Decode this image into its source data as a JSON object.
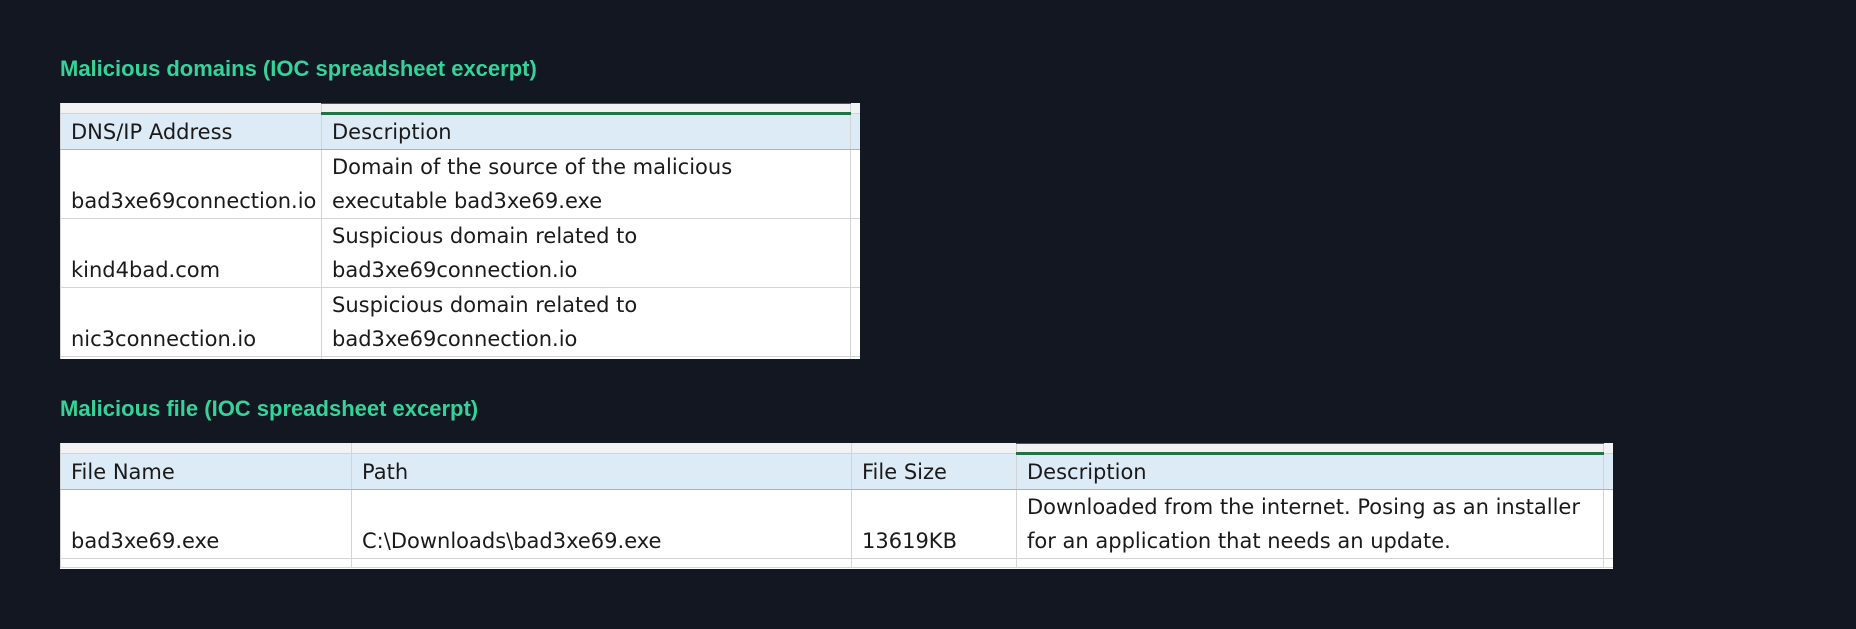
{
  "domains_section": {
    "title": "Malicious domains (IOC spreadsheet excerpt)",
    "headers": [
      "DNS/IP Address",
      "Description"
    ],
    "rows": [
      {
        "address": "bad3xe69connection.io",
        "description": "Domain of the source of the malicious executable bad3xe69.exe"
      },
      {
        "address": "kind4bad.com",
        "description": "Suspicious domain related to bad3xe69connection.io"
      },
      {
        "address": "nic3connection.io",
        "description": "Suspicious domain related to bad3xe69connection.io"
      }
    ]
  },
  "files_section": {
    "title": "Malicious file (IOC spreadsheet excerpt)",
    "headers": [
      "File Name",
      "Path",
      "File Size",
      "Description"
    ],
    "rows": [
      {
        "file_name": "bad3xe69.exe",
        "path": "C:\\Downloads\\bad3xe69.exe",
        "file_size": "13619KB",
        "description": "Downloaded from the internet. Posing as an installer for an application that needs an update."
      }
    ]
  },
  "colors": {
    "background": "#131722",
    "title": "#34d399",
    "header_fill": "#ddebf7",
    "selection_border": "#217346"
  }
}
